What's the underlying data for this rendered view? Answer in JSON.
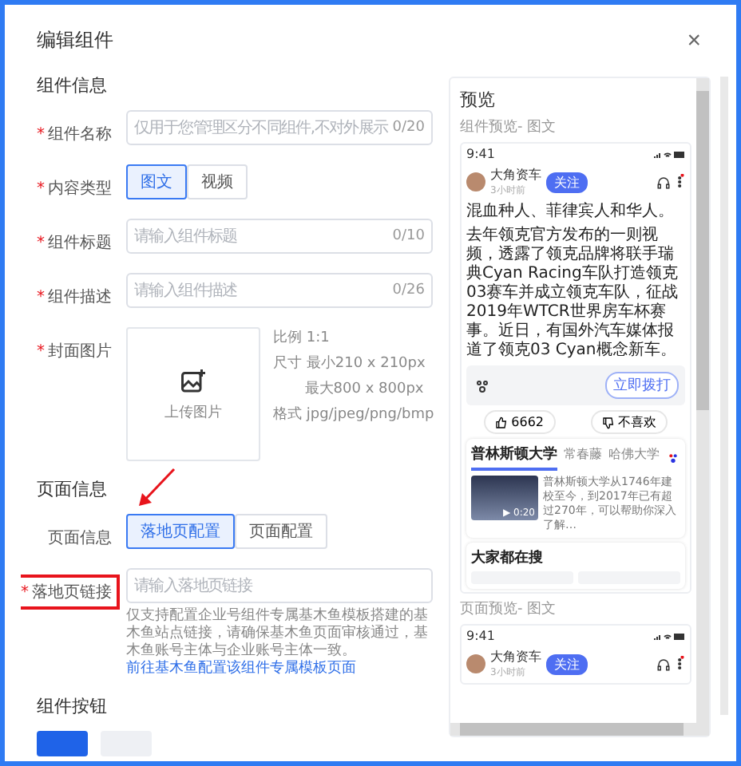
{
  "dialog": {
    "title": "编辑组件",
    "close": "×"
  },
  "component_info": {
    "heading": "组件信息",
    "fields": [
      {
        "kind": "input",
        "label": "组件名称",
        "marker": "*",
        "placeholder": "仅用于您管理区分不同组件,不对外展示",
        "count": "0/20"
      },
      {
        "kind": "segmented",
        "label": "内容类型",
        "marker": "*",
        "options": [
          {
            "label": "图文",
            "selected": true
          },
          {
            "label": "视频",
            "selected": false
          }
        ]
      },
      {
        "kind": "input",
        "label": "组件标题",
        "marker": "*",
        "placeholder": "请输入组件标题",
        "count": "0/10"
      },
      {
        "kind": "input",
        "label": "组件描述",
        "marker": "*",
        "placeholder": "请输入组件描述",
        "count": "0/26"
      },
      {
        "kind": "upload",
        "label": "封面图片",
        "marker": "*",
        "button": "上传图片",
        "specs": [
          {
            "name": "比例",
            "value": "1:1"
          },
          {
            "name": "尺寸",
            "value": "最小210 x 210px"
          },
          {
            "value": "最大800 x 800px"
          },
          {
            "name": "格式",
            "value": "jpg/jpeg/png/bmp"
          }
        ]
      }
    ]
  },
  "page_info": {
    "heading": "页面信息",
    "fields": [
      {
        "kind": "segmented",
        "label": "页面信息",
        "options": [
          {
            "label": "落地页配置",
            "selected": true
          },
          {
            "label": "页面配置",
            "selected": false
          }
        ]
      },
      {
        "kind": "input",
        "label": "落地页链接",
        "marker": "*",
        "highlighted": true,
        "placeholder": "请输入落地页链接",
        "hint": "仅支持配置企业号组件专属基木鱼模板搭建的基木鱼站点链接，请确保基木鱼页面审核通过，基木鱼账号主体与企业账号主体一致。",
        "hint_link": "前往基木鱼配置该组件专属模板页面"
      }
    ]
  },
  "buttons_section": {
    "heading": "组件按钮"
  },
  "preview": {
    "title": "预览",
    "component_label": "组件预览- 图文",
    "phone": {
      "time": "9:41",
      "author": "大角资车",
      "posted": "3小时前",
      "follow": "关注",
      "text_top": "混血种人、菲律宾人和华人。",
      "paragraph": "去年领克官方发布的一则视频，透露了领克品牌将联手瑞典Cyan Racing车队打造领克03赛车并成立领克车队，征战2019年WTCR世界房车杯赛事。近日，有国外汽车媒体报道了领克03 Cyan概念新车。",
      "call_button": "立即拨打",
      "likes": "6662",
      "dislike": "不喜欢",
      "search_card": {
        "tabs": [
          {
            "label": "普林斯顿大学",
            "selected": true
          },
          {
            "label": "常春藤",
            "selected": false
          },
          {
            "label": "哈佛大学",
            "selected": false
          }
        ],
        "video_time": "▶ 0:20",
        "summary": "普林斯顿大学从1746年建校至今，到2017年已有超过270年，可以帮助你深入了解…"
      },
      "hot_title": "大家都在搜"
    },
    "page_label": "页面预览- 图文",
    "phone2": {
      "time": "9:41",
      "author": "大角资车",
      "posted": "3小时前",
      "follow": "关注"
    }
  }
}
